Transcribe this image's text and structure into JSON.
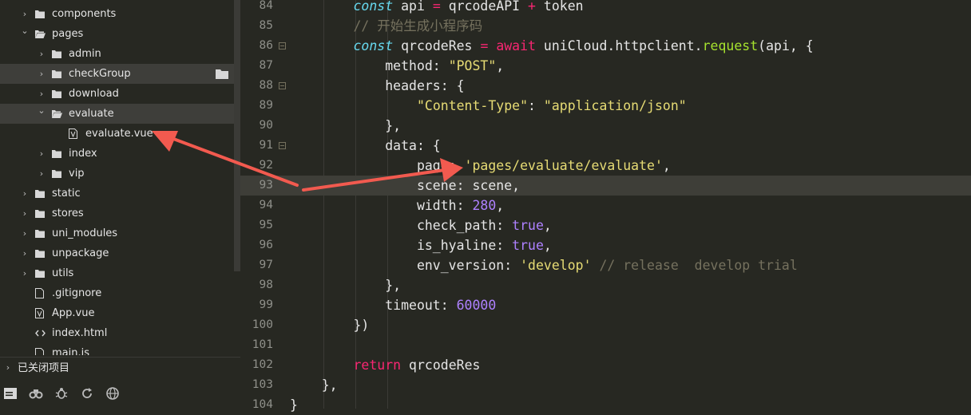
{
  "sidebar": {
    "tree": [
      {
        "label": "components",
        "type": "folder",
        "expanded": false
      },
      {
        "label": "pages",
        "type": "folder",
        "expanded": true
      },
      {
        "label": "admin",
        "type": "folder",
        "expanded": false
      },
      {
        "label": "checkGroup",
        "type": "folder",
        "expanded": false
      },
      {
        "label": "download",
        "type": "folder",
        "expanded": false
      },
      {
        "label": "evaluate",
        "type": "folder",
        "expanded": true
      },
      {
        "label": "evaluate.vue",
        "type": "vue-file"
      },
      {
        "label": "index",
        "type": "folder",
        "expanded": false
      },
      {
        "label": "vip",
        "type": "folder",
        "expanded": false
      },
      {
        "label": "static",
        "type": "folder",
        "expanded": false
      },
      {
        "label": "stores",
        "type": "folder",
        "expanded": false
      },
      {
        "label": "uni_modules",
        "type": "folder",
        "expanded": false
      },
      {
        "label": "unpackage",
        "type": "folder",
        "expanded": false
      },
      {
        "label": "utils",
        "type": "folder",
        "expanded": false
      },
      {
        "label": ".gitignore",
        "type": "file"
      },
      {
        "label": "App.vue",
        "type": "vue-file"
      },
      {
        "label": "index.html",
        "type": "html-file"
      },
      {
        "label": "main.js",
        "type": "file"
      }
    ],
    "closed_items_label": "已关闭项目",
    "bottom_icons": [
      "explorer-icon",
      "binoculars-icon",
      "bug-icon",
      "refresh-icon",
      "globe-icon"
    ]
  },
  "editor": {
    "lines": [
      {
        "num": "84",
        "fold": false,
        "html": "        <span class=\"k\">const</span> api <span class=\"r\">=</span> qrcodeAPI <span class=\"r\">+</span> token"
      },
      {
        "num": "85",
        "fold": false,
        "html": "        <span class=\"c\">// 开始生成小程序码</span>"
      },
      {
        "num": "86",
        "fold": true,
        "html": "        <span class=\"k\">const</span> qrcodeRes <span class=\"r\">=</span> <span class=\"r\">await</span> uniCloud.httpclient.<span class=\"f\">request</span>(api, {"
      },
      {
        "num": "87",
        "fold": false,
        "html": "            method: <span class=\"s\">\"POST\"</span>,"
      },
      {
        "num": "88",
        "fold": true,
        "html": "            headers: {"
      },
      {
        "num": "89",
        "fold": false,
        "html": "                <span class=\"s\">\"Content-Type\"</span>: <span class=\"s\">\"application/json\"</span>"
      },
      {
        "num": "90",
        "fold": false,
        "html": "            },"
      },
      {
        "num": "91",
        "fold": true,
        "html": "            data: {"
      },
      {
        "num": "92",
        "fold": false,
        "html": "                page: <span class=\"s\">'pages/evaluate/evaluate'</span>,"
      },
      {
        "num": "93",
        "fold": false,
        "html": "                scene: scene,",
        "current": true
      },
      {
        "num": "94",
        "fold": false,
        "html": "                width: <span class=\"n\">280</span>,"
      },
      {
        "num": "95",
        "fold": false,
        "html": "                check_path: <span class=\"n\">true</span>,"
      },
      {
        "num": "96",
        "fold": false,
        "html": "                is_hyaline: <span class=\"n\">true</span>,"
      },
      {
        "num": "97",
        "fold": false,
        "html": "                env_version: <span class=\"s\">'develop'</span> <span class=\"c\">// release  develop trial</span>"
      },
      {
        "num": "98",
        "fold": false,
        "html": "            },"
      },
      {
        "num": "99",
        "fold": false,
        "html": "            timeout: <span class=\"n\">60000</span>"
      },
      {
        "num": "100",
        "fold": false,
        "html": "        })"
      },
      {
        "num": "101",
        "fold": false,
        "html": ""
      },
      {
        "num": "102",
        "fold": false,
        "html": "        <span class=\"r\">return</span> qrcodeRes"
      },
      {
        "num": "103",
        "fold": false,
        "html": "    },"
      },
      {
        "num": "104",
        "fold": false,
        "html": "}"
      }
    ]
  },
  "colors": {
    "background": "#272822",
    "annotation_arrow": "#f25a4f"
  }
}
